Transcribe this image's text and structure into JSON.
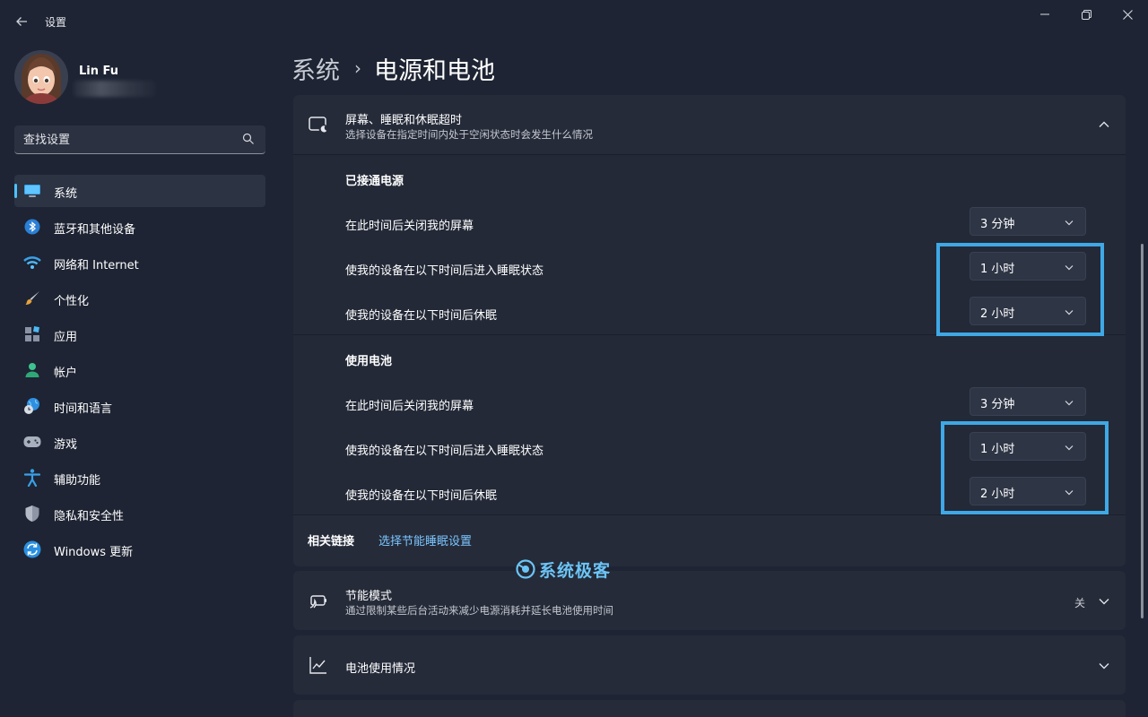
{
  "window": {
    "app_title": "设置",
    "back_icon": "arrow-left-icon"
  },
  "user": {
    "name": "Lin Fu"
  },
  "search": {
    "placeholder": "查找设置"
  },
  "sidebar": {
    "items": [
      {
        "label": "系统",
        "icon": "monitor-icon",
        "selected": true
      },
      {
        "label": "蓝牙和其他设备",
        "icon": "bluetooth-icon"
      },
      {
        "label": "网络和 Internet",
        "icon": "wifi-icon"
      },
      {
        "label": "个性化",
        "icon": "brush-icon"
      },
      {
        "label": "应用",
        "icon": "apps-icon"
      },
      {
        "label": "帐户",
        "icon": "person-icon"
      },
      {
        "label": "时间和语言",
        "icon": "globe-clock-icon"
      },
      {
        "label": "游戏",
        "icon": "gamepad-icon"
      },
      {
        "label": "辅助功能",
        "icon": "accessibility-icon"
      },
      {
        "label": "隐私和安全性",
        "icon": "shield-icon"
      },
      {
        "label": "Windows 更新",
        "icon": "update-icon"
      }
    ]
  },
  "breadcrumb": {
    "parent": "系统",
    "separator": "›",
    "current": "电源和电池"
  },
  "screen_sleep": {
    "title": "屏幕、睡眠和休眠超时",
    "subtitle": "选择设备在指定时间内处于空闲状态时会发生什么情况",
    "expanded": true,
    "plugged_in": {
      "title": "已接通电源",
      "rows": [
        {
          "label": "在此时间后关闭我的屏幕",
          "value": "3 分钟"
        },
        {
          "label": "使我的设备在以下时间后进入睡眠状态",
          "value": "1 小时"
        },
        {
          "label": "使我的设备在以下时间后休眠",
          "value": "2 小时"
        }
      ]
    },
    "on_battery": {
      "title": "使用电池",
      "rows": [
        {
          "label": "在此时间后关闭我的屏幕",
          "value": "3 分钟"
        },
        {
          "label": "使我的设备在以下时间后进入睡眠状态",
          "value": "1 小时"
        },
        {
          "label": "使我的设备在以下时间后休眠",
          "value": "2 小时"
        }
      ]
    },
    "related": {
      "title": "相关链接",
      "link": "选择节能睡眠设置"
    }
  },
  "energy_saver": {
    "title": "节能模式",
    "subtitle": "通过限制某些后台活动来减少电源消耗并延长电池使用时间",
    "status": "关"
  },
  "battery_usage": {
    "title": "电池使用情况"
  },
  "watermark": {
    "text": "系统极客"
  },
  "colors": {
    "background": "#1e2433",
    "card": "#252b39",
    "accent": "#4cc2ff",
    "highlight_box": "#3fa8e6",
    "link": "#7cc6ff"
  }
}
